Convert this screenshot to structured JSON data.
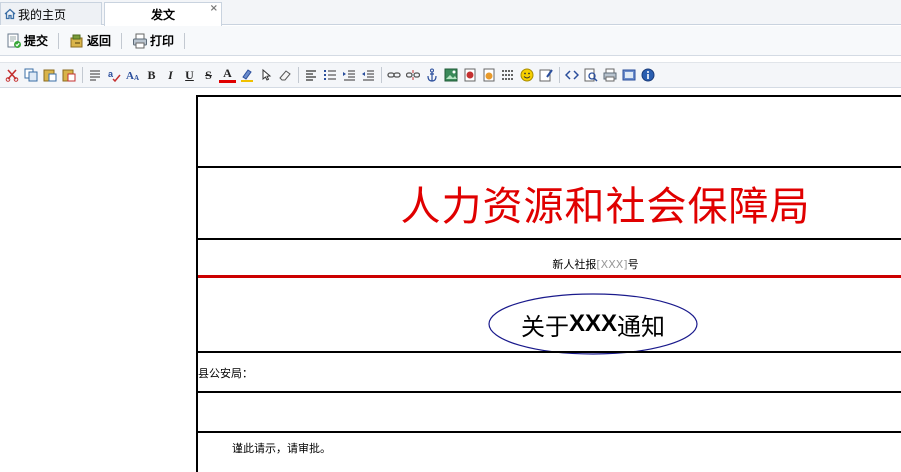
{
  "tabs": [
    {
      "label": "我的主页",
      "icon": "home-icon"
    },
    {
      "label": "发文",
      "close": "×"
    }
  ],
  "actions": [
    {
      "label": "提交",
      "icon": "submit-icon"
    },
    {
      "label": "返回",
      "icon": "return-icon"
    },
    {
      "label": "打印",
      "icon": "print-icon"
    }
  ],
  "editor_toolbar": {
    "bold": "B",
    "italic": "I",
    "underline": "U",
    "strike": "S",
    "font_color": "A",
    "icons": [
      "cut-icon",
      "copy-icon",
      "paste-icon",
      "paste-text-icon",
      "paragraph-icon",
      "spellcheck-icon",
      "font-size-icon",
      "bold-icon",
      "italic-icon",
      "underline-icon",
      "strikethrough-icon",
      "font-color-icon",
      "highlight-icon",
      "select-icon",
      "eraser-icon",
      "align-left-icon",
      "ordered-list-icon",
      "indent-icon",
      "outdent-icon",
      "link-icon",
      "unlink-icon",
      "anchor-icon",
      "image-icon",
      "flash-icon",
      "media-icon",
      "hr-icon",
      "emoticon-icon",
      "special-char-icon",
      "source-icon",
      "preview-icon",
      "print-icon",
      "fullscreen-icon",
      "about-icon"
    ]
  },
  "document": {
    "org_title": "人力资源和社会保障局",
    "doc_number_prefix": "新人社报",
    "doc_number_placeholder": "[XXX]",
    "doc_number_suffix": "号",
    "subject_prefix": "关于",
    "subject_xxx": "XXX",
    "subject_suffix": "通知",
    "recipient": "县公安局：",
    "closing": "谨此请示，请审批。"
  },
  "colors": {
    "title_red": "#e00000",
    "red_rule": "#cc0000",
    "ellipse_stroke": "#1a1a8c"
  }
}
